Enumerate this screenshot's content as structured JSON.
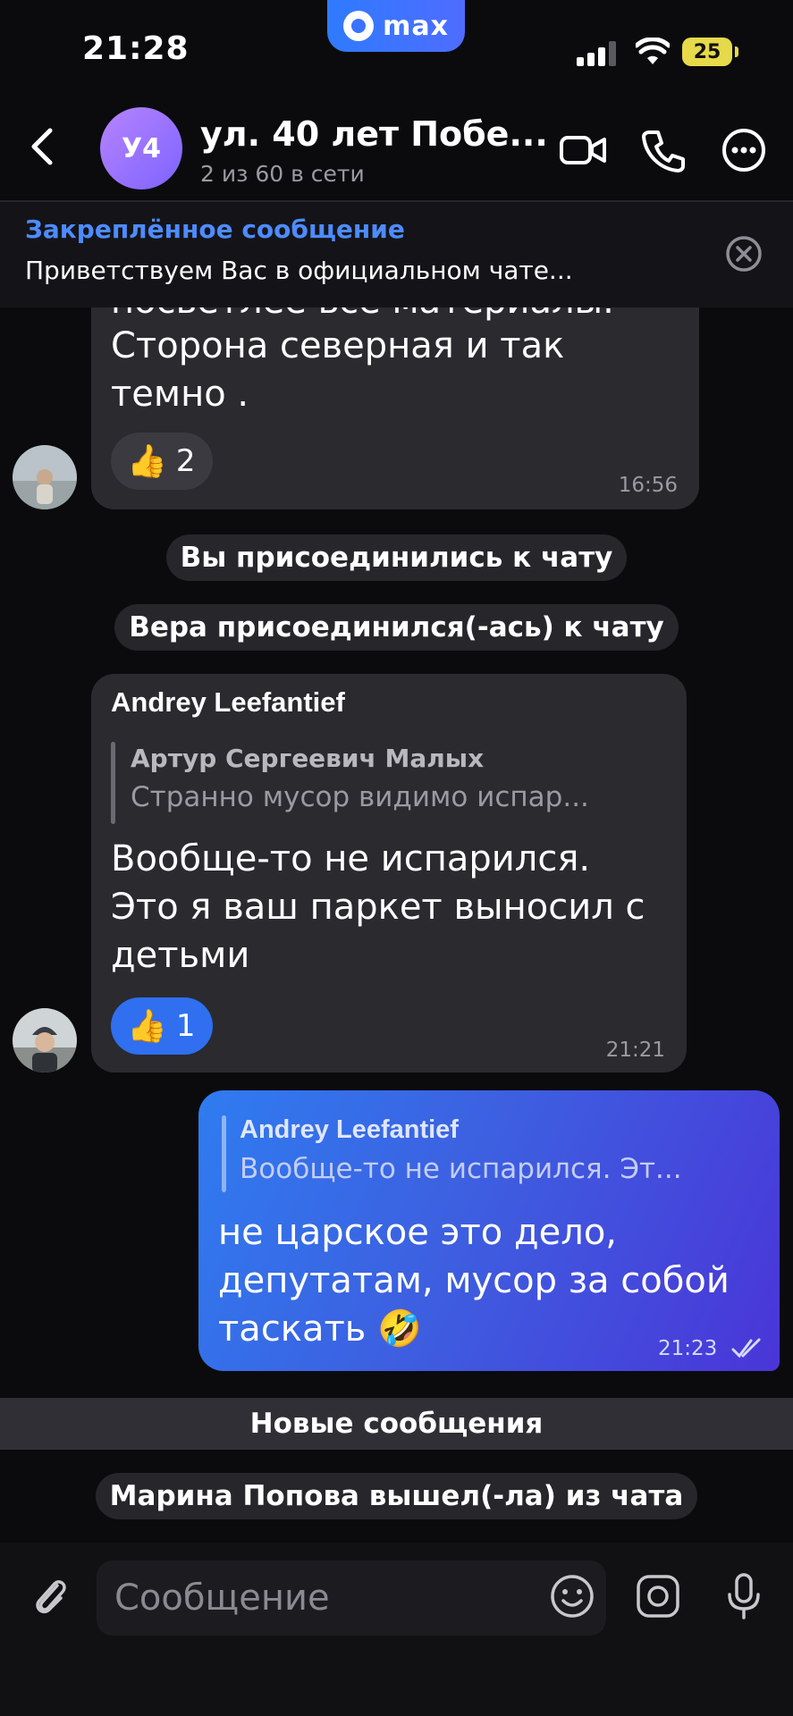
{
  "status_bar": {
    "time": "21:28",
    "app_badge": "max",
    "battery": "25"
  },
  "header": {
    "avatar_initials": "У4",
    "title": "ул. 40 лет Побе...",
    "subtitle": "2 из 60 в сети",
    "icons": [
      "back-icon",
      "video-call-icon",
      "phone-icon",
      "more-icon"
    ]
  },
  "pinned": {
    "label": "Закреплённое сообщение",
    "text": "Приветствуем Вас в официальном чате..."
  },
  "messages": [
    {
      "type": "incoming",
      "cut_top_line": "посветлее все материалы.",
      "text_lines": [
        "Сторона северная и так",
        "темно ."
      ],
      "reaction": {
        "emoji": "👍",
        "count": "2"
      },
      "time": "16:56"
    },
    {
      "type": "system",
      "text": "Вы присоединились к чату"
    },
    {
      "type": "system",
      "text": "Вера присоединился(-ась) к чату"
    },
    {
      "type": "incoming",
      "sender": "Andrey Leefantief",
      "reply_author": "Артур Сергеевич Малых",
      "reply_text": "Странно мусор видимо испар...",
      "text_lines": [
        "Вообще-то не испарился.",
        "Это я ваш паркет выносил с",
        "детьми"
      ],
      "reaction": {
        "emoji": "👍",
        "count": "1"
      },
      "time": "21:21"
    },
    {
      "type": "outgoing",
      "reply_author": "Andrey Leefantief",
      "reply_text": "Вообще-то не испарился. Эт...",
      "text_lines": [
        "не царское это дело,",
        "депутатам, мусор за собой",
        "таскать 🤣"
      ],
      "time": "21:23"
    }
  ],
  "new_messages_label": "Новые сообщения",
  "last_system": "Марина Попова вышел(-ла) из чата",
  "composer": {
    "placeholder": "Сообщение",
    "icons": [
      "attach-icon",
      "emoji-icon",
      "camera-icon",
      "microphone-icon"
    ]
  },
  "colors": {
    "background": "#0b0b0e",
    "bubble_in": "#2a2a2f",
    "accent_blue": "#4d8bff",
    "reaction_active": "#2f6ff0",
    "outgoing_gradient_start": "#2f7cf0",
    "outgoing_gradient_end": "#4a35d8"
  }
}
